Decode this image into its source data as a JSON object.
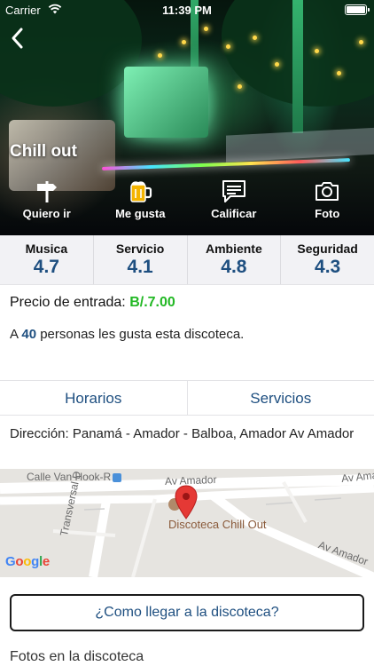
{
  "status_bar": {
    "carrier": "Carrier",
    "time": "11:39 PM"
  },
  "venue": {
    "name": "Chill out"
  },
  "actions": [
    {
      "label": "Quiero ir",
      "icon": "signpost-icon"
    },
    {
      "label": "Me gusta",
      "icon": "beer-mug-icon"
    },
    {
      "label": "Calificar",
      "icon": "comment-icon"
    },
    {
      "label": "Foto",
      "icon": "camera-icon"
    }
  ],
  "ratings": [
    {
      "label": "Musica",
      "value": "4.7"
    },
    {
      "label": "Servicio",
      "value": "4.1"
    },
    {
      "label": "Ambiente",
      "value": "4.8"
    },
    {
      "label": "Seguridad",
      "value": "4.3"
    }
  ],
  "price": {
    "label": "Precio de entrada:",
    "amount": "B/.7.00"
  },
  "likes": {
    "prefix": "A",
    "count": "40",
    "suffix": "personas les gusta esta discoteca."
  },
  "tabs": [
    {
      "label": "Horarios"
    },
    {
      "label": "Servicios"
    }
  ],
  "address": {
    "text": "Dirección: Panamá - Amador - Balboa, Amador Av Amador"
  },
  "map": {
    "street_1": "Calle Van Hook-R",
    "street_2": "Av Amador",
    "street_3": "Av Amador",
    "street_4": "Av Amador",
    "street_5": "Transversal D",
    "place": "Discoteca Chill Out",
    "provider": "Google",
    "colors": {
      "marker": "#e53935",
      "road": "#ffffff",
      "land": "#e6e4e0"
    }
  },
  "directions_button": {
    "label": "¿Como llegar a la discoteca?"
  },
  "photos_section": {
    "title": "Fotos en la discoteca"
  },
  "colors": {
    "accent_blue": "#1e4f80",
    "price_green": "#22b824"
  }
}
